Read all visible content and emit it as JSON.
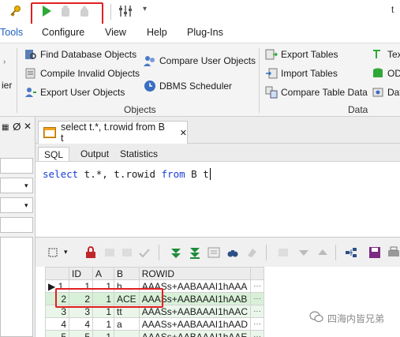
{
  "quick_access": {
    "icons": [
      "key-icon",
      "run-icon",
      "stop-icon",
      "break-icon",
      "settings-icon",
      "dropdown-icon"
    ]
  },
  "menu": {
    "items": [
      "Tools",
      "Configure",
      "View",
      "Help",
      "Plug-Ins"
    ]
  },
  "ribbon": {
    "left_partial": "ier",
    "objects": {
      "find_db_objects": "Find Database Objects",
      "compile_invalid": "Compile Invalid Objects",
      "export_user_objects": "Export User Objects",
      "compare_user_objects": "Compare User Objects",
      "dbms_scheduler": "DBMS Scheduler",
      "group_label": "Objects"
    },
    "data": {
      "export_tables": "Export Tables",
      "import_tables": "Import Tables",
      "compare_table_data": "Compare Table Data",
      "partial_1": "Tex",
      "partial_2": "OD",
      "partial_3": "Dat",
      "group_label": "Data"
    }
  },
  "editor": {
    "tab_title": "select t.*, t.rowid from B t",
    "close": "✕",
    "subtabs": [
      "SQL",
      "Output",
      "Statistics"
    ],
    "sql": {
      "kw_select": "select",
      "rest1": " t.*, t.rowid ",
      "kw_from": "from",
      "rest2": " B t"
    }
  },
  "grid": {
    "columns": [
      "ID",
      "A",
      "B",
      "ROWID"
    ],
    "rows": [
      {
        "num": "1",
        "id": "1",
        "a": "1",
        "b": "h",
        "rowid": "AAASs+AABAAAI1hAAA"
      },
      {
        "num": "2",
        "id": "2",
        "a": "1",
        "b": "ACE",
        "rowid": "AAASs+AABAAAI1hAAB"
      },
      {
        "num": "3",
        "id": "3",
        "a": "1",
        "b": "tt",
        "rowid": "AAASs+AABAAAI1hAAC"
      },
      {
        "num": "4",
        "id": "4",
        "a": "1",
        "b": "a",
        "rowid": "AAASs+AABAAAI1hAAD"
      },
      {
        "num": "5",
        "id": "5",
        "a": "1",
        "b": "…",
        "rowid": "AAASs+AABAAAI1hAAE"
      }
    ],
    "ellipsis": "···"
  },
  "watermark": "四海内皆兄弟",
  "colors": {
    "highlight_border": "#e02020",
    "keyword": "#1a3fd6",
    "selected_row": "#d8f0d8"
  }
}
